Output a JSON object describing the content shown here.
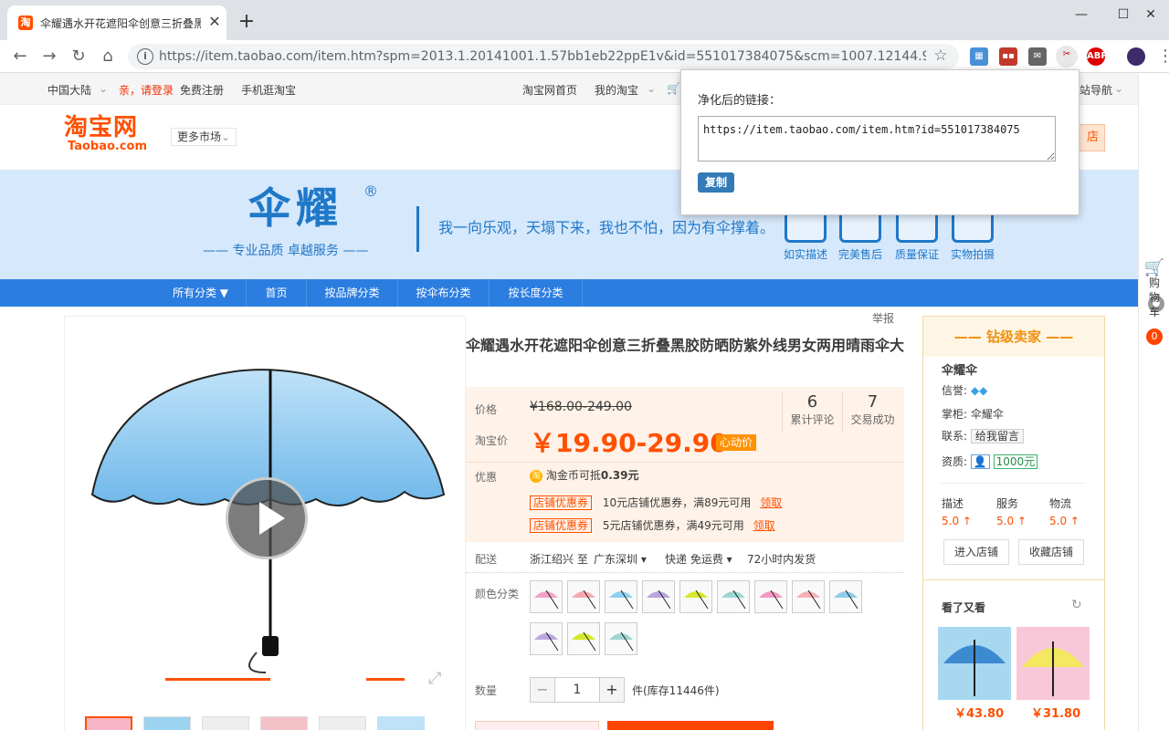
{
  "browser": {
    "tab_title": "伞耀遇水开花遮阳伞创意三折叠黑",
    "tab_favicon": "淘",
    "url": "https://item.taobao.com/item.htm?spm=2013.1.20141001.1.57bb1eb22ppE1v&id=551017384075&scm=1007.12144.9522...",
    "extensions": [
      "grid-icon",
      "mail-icon",
      "link-cleaner-icon",
      "ABP",
      "profile-icon"
    ]
  },
  "topbar": {
    "region": "中国大陆",
    "login": "亲，请登录",
    "register": "免费注册",
    "mobile": "手机逛淘宝",
    "home": "淘宝网首页",
    "my_taobao": "我的淘宝",
    "site_nav": "站导航"
  },
  "header": {
    "logo_cn": "淘宝网",
    "logo_en": "Taobao.com",
    "more_market": "更多市场",
    "enter_store": "店"
  },
  "banner": {
    "brand": "伞耀",
    "reg": "®",
    "brand_sub": "—— 专业品质  卓越服务 ——",
    "slogan": "我一向乐观，天塌下来，我也不怕，因为有伞撑着。",
    "services": [
      "如实描述",
      "完美售后",
      "质量保证",
      "实物拍摄"
    ]
  },
  "nav": {
    "items": [
      "所有分类 ▼",
      "首页",
      "按品牌分类",
      "按伞布分类",
      "按长度分类"
    ]
  },
  "report": "举报",
  "product": {
    "title": "伞耀遇水开花遮阳伞创意三折叠黑胶防晒防紫外线男女两用晴雨伞大",
    "price_label": "价格",
    "orig_price": "¥168.00-249.00",
    "tb_price_label": "淘宝价",
    "tb_price": "￥19.90-29.90",
    "promo_tag": "心动价",
    "reviews_count": "6",
    "reviews_label": "累计评论",
    "sales_count": "7",
    "sales_label": "交易成功",
    "offer_label": "优惠",
    "coin_text": "淘金币可抵",
    "coin_value": "0.39元",
    "coupons": [
      {
        "tag": "店铺优惠券",
        "text": "10元店铺优惠券，满89元可用",
        "link": "领取"
      },
      {
        "tag": "店铺优惠券",
        "text": "5元店铺优惠券，满49元可用",
        "link": "领取"
      }
    ],
    "delivery_label": "配送",
    "delivery_from": "浙江绍兴 至",
    "delivery_to": "广东深圳",
    "delivery_method": "快递 免运费",
    "ship_time": "72小时内发货",
    "color_label": "颜色分类",
    "qty_label": "数量",
    "qty_value": "1",
    "stock": "件(库存11446件)"
  },
  "seller": {
    "title": "钻级卖家",
    "name": "伞耀伞",
    "credit_label": "信誉:",
    "keeper_label": "掌柜:",
    "keeper": "伞耀伞",
    "contact_label": "联系:",
    "contact": "给我留言",
    "qual_label": "资质:",
    "qual_value": "1000元",
    "ratings": [
      {
        "label": "描述",
        "value": "5.0 ↑"
      },
      {
        "label": "服务",
        "value": "5.0 ↑"
      },
      {
        "label": "物流",
        "value": "5.0 ↑"
      }
    ],
    "enter_store": "进入店铺",
    "fav_store": "收藏店铺",
    "also_viewed": "看了又看",
    "rec_prices": [
      "￥43.80",
      "￥31.80"
    ]
  },
  "sidebar": {
    "cart": "购物车",
    "count": "0"
  },
  "popup": {
    "title": "净化后的链接：",
    "url": "https://item.taobao.com/item.htm?id=551017384075",
    "copy": "复制"
  }
}
